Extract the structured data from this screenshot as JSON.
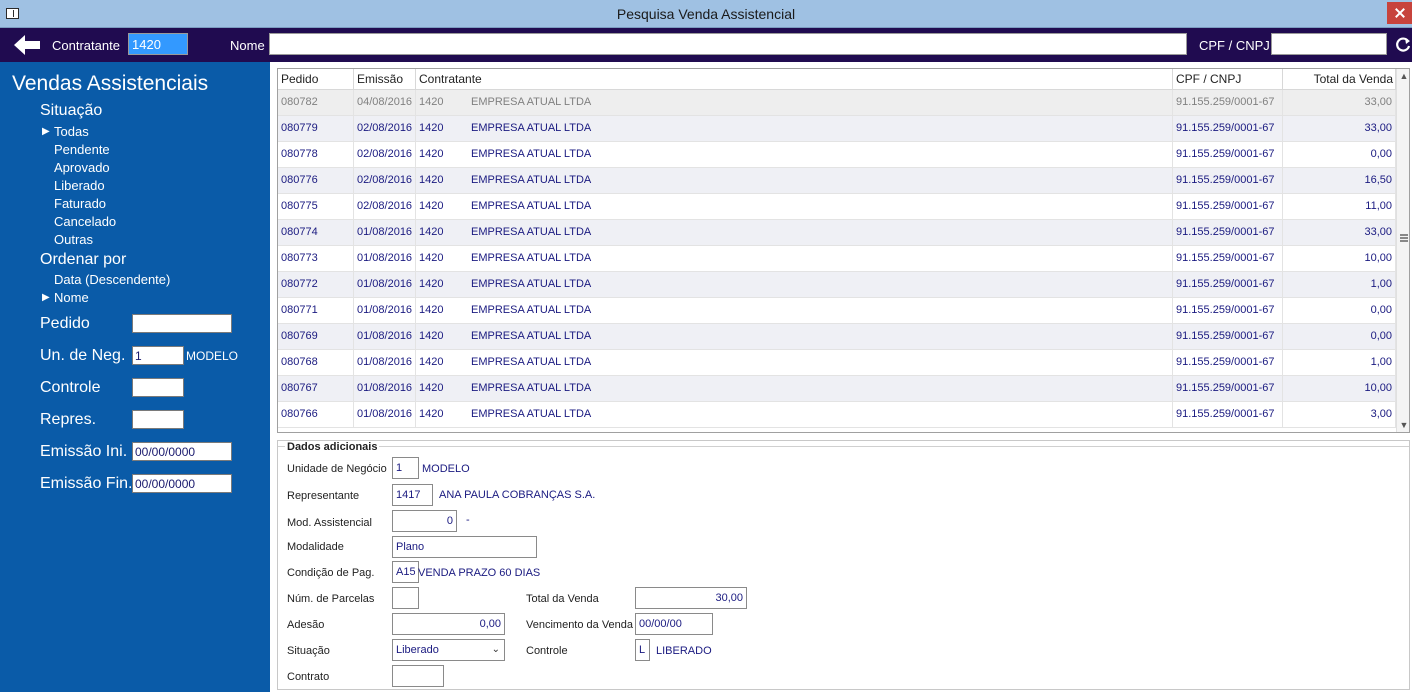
{
  "window": {
    "title": "Pesquisa Venda Assistencial"
  },
  "topbar": {
    "contratante_label": "Contratante",
    "contratante_value": "1420",
    "nome_label": "Nome",
    "nome_value": "",
    "cpf_label": "CPF / CNPJ",
    "cpf_value": ""
  },
  "sidebar": {
    "heading": "Vendas Assistenciais",
    "situacao_label": "Situação",
    "situacao_options": [
      "Todas",
      "Pendente",
      "Aprovado",
      "Liberado",
      "Faturado",
      "Cancelado",
      "Outras"
    ],
    "situacao_selected": "Todas",
    "ordenar_label": "Ordenar por",
    "ordenar_options": [
      "Data (Descendente)",
      "Nome"
    ],
    "ordenar_selected": "Nome",
    "filters": {
      "pedido_label": "Pedido",
      "pedido_value": "",
      "un_neg_label": "Un. de Neg.",
      "un_neg_value": "1",
      "un_neg_desc": "MODELO",
      "controle_label": "Controle",
      "controle_value": "",
      "repres_label": "Repres.",
      "repres_value": "",
      "emissao_ini_label": "Emissão Ini.",
      "emissao_ini_value": "00/00/0000",
      "emissao_fin_label": "Emissão Fin.",
      "emissao_fin_value": "00/00/0000"
    }
  },
  "grid": {
    "columns": [
      "Pedido",
      "Emissão",
      "Contratante",
      "CPF / CNPJ",
      "Total da Venda"
    ],
    "rows": [
      {
        "pedido": "080782",
        "emissao": "04/08/2016",
        "cod": "1420",
        "nome": "EMPRESA ATUAL LTDA",
        "cpf": "91.155.259/0001-67",
        "total": "33,00"
      },
      {
        "pedido": "080779",
        "emissao": "02/08/2016",
        "cod": "1420",
        "nome": "EMPRESA ATUAL LTDA",
        "cpf": "91.155.259/0001-67",
        "total": "33,00"
      },
      {
        "pedido": "080778",
        "emissao": "02/08/2016",
        "cod": "1420",
        "nome": "EMPRESA ATUAL LTDA",
        "cpf": "91.155.259/0001-67",
        "total": "0,00"
      },
      {
        "pedido": "080776",
        "emissao": "02/08/2016",
        "cod": "1420",
        "nome": "EMPRESA ATUAL LTDA",
        "cpf": "91.155.259/0001-67",
        "total": "16,50"
      },
      {
        "pedido": "080775",
        "emissao": "02/08/2016",
        "cod": "1420",
        "nome": "EMPRESA ATUAL LTDA",
        "cpf": "91.155.259/0001-67",
        "total": "11,00"
      },
      {
        "pedido": "080774",
        "emissao": "01/08/2016",
        "cod": "1420",
        "nome": "EMPRESA ATUAL LTDA",
        "cpf": "91.155.259/0001-67",
        "total": "33,00"
      },
      {
        "pedido": "080773",
        "emissao": "01/08/2016",
        "cod": "1420",
        "nome": "EMPRESA ATUAL LTDA",
        "cpf": "91.155.259/0001-67",
        "total": "10,00"
      },
      {
        "pedido": "080772",
        "emissao": "01/08/2016",
        "cod": "1420",
        "nome": "EMPRESA ATUAL LTDA",
        "cpf": "91.155.259/0001-67",
        "total": "1,00"
      },
      {
        "pedido": "080771",
        "emissao": "01/08/2016",
        "cod": "1420",
        "nome": "EMPRESA ATUAL LTDA",
        "cpf": "91.155.259/0001-67",
        "total": "0,00"
      },
      {
        "pedido": "080769",
        "emissao": "01/08/2016",
        "cod": "1420",
        "nome": "EMPRESA ATUAL LTDA",
        "cpf": "91.155.259/0001-67",
        "total": "0,00"
      },
      {
        "pedido": "080768",
        "emissao": "01/08/2016",
        "cod": "1420",
        "nome": "EMPRESA ATUAL LTDA",
        "cpf": "91.155.259/0001-67",
        "total": "1,00"
      },
      {
        "pedido": "080767",
        "emissao": "01/08/2016",
        "cod": "1420",
        "nome": "EMPRESA ATUAL LTDA",
        "cpf": "91.155.259/0001-67",
        "total": "10,00"
      },
      {
        "pedido": "080766",
        "emissao": "01/08/2016",
        "cod": "1420",
        "nome": "EMPRESA ATUAL LTDA",
        "cpf": "91.155.259/0001-67",
        "total": "3,00"
      }
    ]
  },
  "details": {
    "legend": "Dados adicionais",
    "unidade_label": "Unidade de Negócio",
    "unidade_value": "1",
    "unidade_desc": "MODELO",
    "representante_label": "Representante",
    "representante_value": "1417",
    "representante_desc": "ANA PAULA COBRANÇAS S.A.",
    "mod_label": "Mod. Assistencial",
    "mod_value": "0",
    "mod_desc": "-",
    "modalidade_label": "Modalidade",
    "modalidade_value": "Plano",
    "condicao_label": "Condição de Pag.",
    "condicao_value": "A15",
    "condicao_desc": "VENDA PRAZO 60 DIAS",
    "parcelas_label": "Núm. de Parcelas",
    "parcelas_value": "",
    "total_label": "Total da Venda",
    "total_value": "30,00",
    "adesao_label": "Adesão",
    "adesao_value": "0,00",
    "vencimento_label": "Vencimento da Venda",
    "vencimento_value": "00/00/00",
    "situacao_label": "Situação",
    "situacao_value": "Liberado",
    "controle_label": "Controle",
    "controle_value": "L",
    "controle_desc": "LIBERADO",
    "contrato_label": "Contrato",
    "contrato_value": ""
  }
}
